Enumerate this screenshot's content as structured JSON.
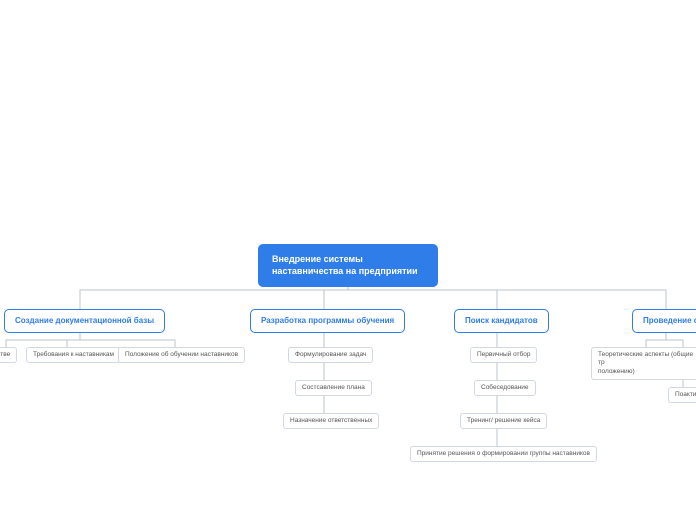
{
  "root": {
    "title_line1": "Внедрение системы",
    "title_line2": "наставничества на предприятии"
  },
  "branches": {
    "docs": {
      "label": "Создание документационной базы",
      "children": {
        "c0": "стве",
        "c1": "Требования к наставникам",
        "c2": "Положение об обучении наставников"
      }
    },
    "program": {
      "label": "Разработка программы обучения",
      "children": {
        "c0": "Формулирование задач",
        "c1": "Состсавление плана",
        "c2": "Назначение ответственных"
      }
    },
    "candidates": {
      "label": "Поиск кандидатов",
      "children": {
        "c0": "Первичный отбор",
        "c1": "Собеседование",
        "c2": "Тренинг/ решение кейса",
        "c3": "Принятие решения о формировании группы наставников"
      }
    },
    "conduct": {
      "label": "Проведение о",
      "children": {
        "c0_l1": "Теоретические аспекты (общие тр",
        "c0_l2": "положению)",
        "c1": "Поактика"
      }
    }
  }
}
